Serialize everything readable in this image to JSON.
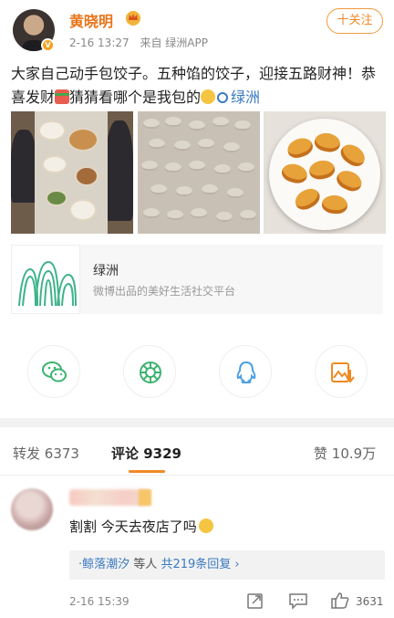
{
  "header": {
    "username": "黄晓明",
    "time": "2-16 13:27",
    "source": "来自 绿洲APP",
    "follow_label": "十关注"
  },
  "post": {
    "text_part1": "大家自己动手包饺子。五种馅的饺子，迎接五路财神！恭喜发财",
    "text_part2": "猜猜看哪个是我包的",
    "link_label": "绿洲"
  },
  "card": {
    "title": "绿洲",
    "subtitle": "微博出品的美好生活社交平台"
  },
  "share": {
    "icons": [
      "wechat-icon",
      "moments-icon",
      "qq-icon",
      "save-image-icon"
    ]
  },
  "tabs": {
    "repost_label": "转发",
    "repost_count": "6373",
    "comment_label": "评论",
    "comment_count": "9329",
    "like_label": "赞",
    "like_count": "10.9万"
  },
  "comment": {
    "text": "割割 今天去夜店了吗",
    "reply_users": "·鲸落潮汐",
    "reply_mid": "等人",
    "reply_count": "共219条回复 ›",
    "time": "2-16 15:39",
    "likes": "3631"
  },
  "colors": {
    "accent": "#f08a24",
    "link": "#3a7ac0",
    "username": "#e8751a"
  }
}
